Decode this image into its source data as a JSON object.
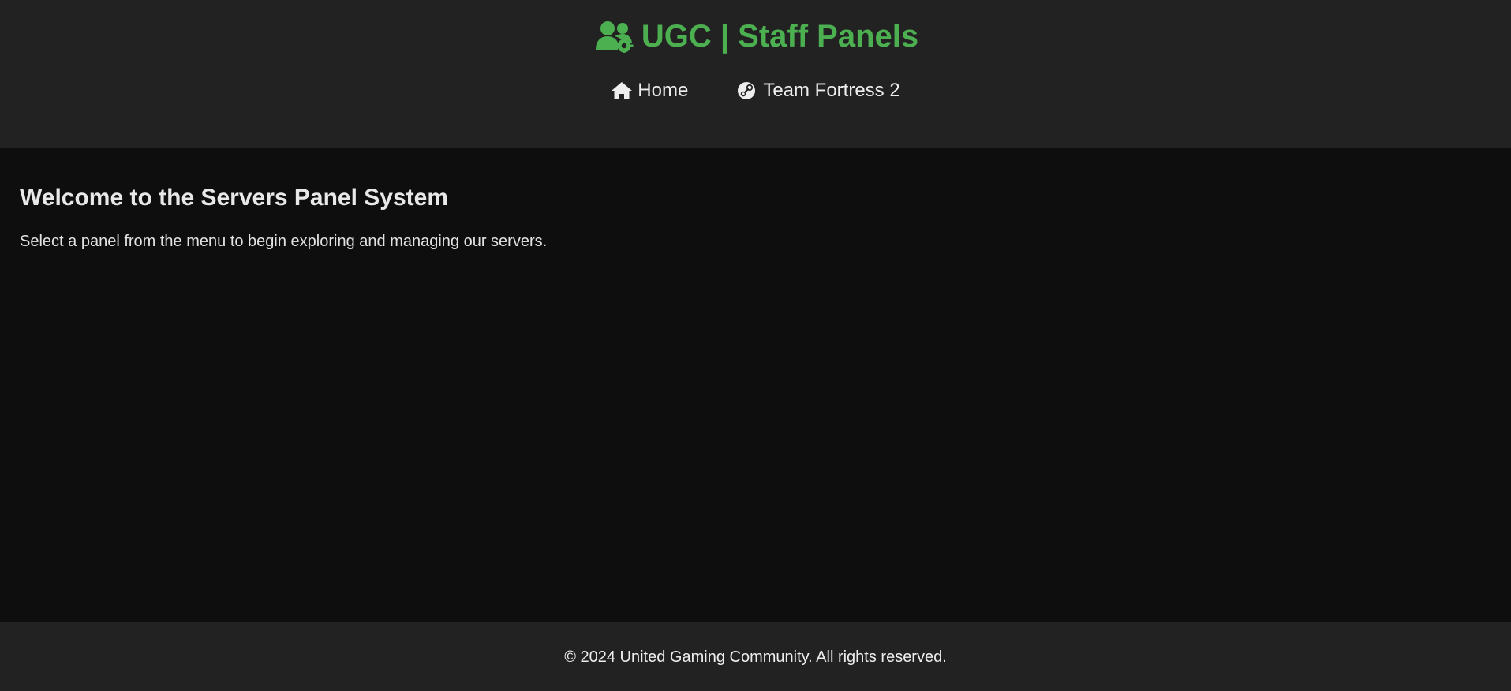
{
  "header": {
    "brand_icon": "users-gear-icon",
    "brand_title": "UGC | Staff Panels",
    "brand_color": "#4caf50",
    "nav": [
      {
        "label": "Home",
        "icon": "home-icon"
      },
      {
        "label": "Team Fortress 2",
        "icon": "steam-icon"
      }
    ]
  },
  "main": {
    "title": "Welcome to the Servers Panel System",
    "subtitle": "Select a panel from the menu to begin exploring and managing our servers."
  },
  "footer": {
    "copyright": "© 2024 United Gaming Community. All rights reserved."
  }
}
